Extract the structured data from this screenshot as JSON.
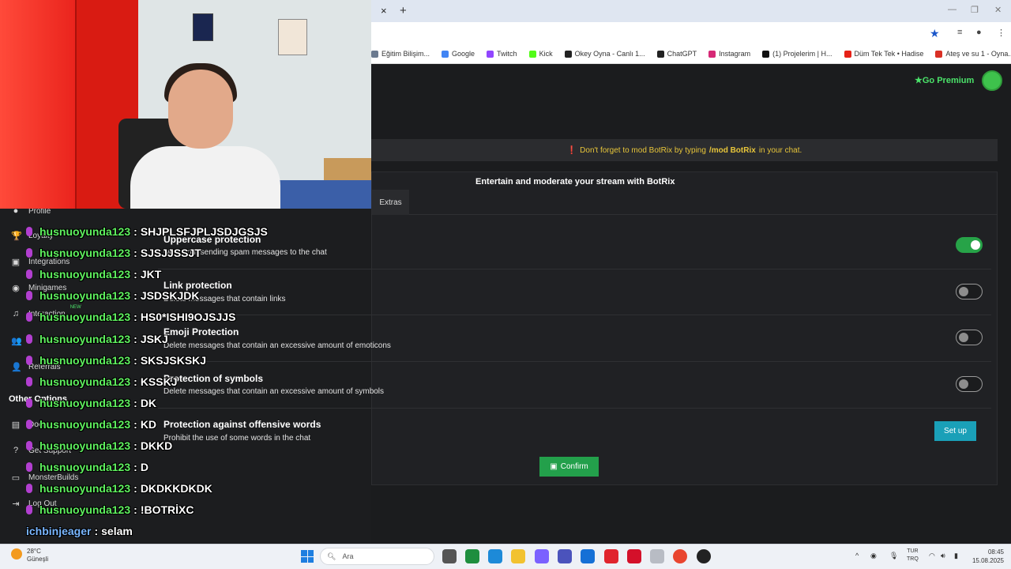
{
  "browser": {
    "close_glyph": "×",
    "new_tab_glyph": "+",
    "window_controls": [
      "—",
      "❐",
      "✕"
    ],
    "bookmarks": [
      {
        "label": "Eğitim Bilişim...",
        "color": "#6b7a8f"
      },
      {
        "label": "Google",
        "color": "#4285f4"
      },
      {
        "label": "Twitch",
        "color": "#9146ff"
      },
      {
        "label": "Kick",
        "color": "#53fc18"
      },
      {
        "label": "Okey Oyna - Canlı 1...",
        "color": "#222222"
      },
      {
        "label": "ChatGPT",
        "color": "#222222"
      },
      {
        "label": "Instagram",
        "color": "#d62976"
      },
      {
        "label": "(1) Projelerim | H...",
        "color": "#111111"
      },
      {
        "label": "Düm Tek Tek • Hadise",
        "color": "#e62117"
      },
      {
        "label": "Ateş ve su 1 - Oyna...",
        "color": "#d93025"
      }
    ]
  },
  "header": {
    "premium_label": "Go Premium",
    "premium_icon": "star-icon"
  },
  "notice": {
    "prefix": "Don't forget to mod BotRix by typing",
    "command": "/mod BotRix",
    "suffix": "in your chat.",
    "icon": "warning-icon"
  },
  "card": {
    "title": "Entertain and moderate your stream with BotRix",
    "active_tab": "Extras"
  },
  "options": [
    {
      "title": "Uppercase protection",
      "desc": "wers from sending spam messages to the chat",
      "enabled": true
    },
    {
      "title": "Link protection",
      "desc": "Delete messages that contain links",
      "enabled": false
    },
    {
      "title": "Emoji Protection",
      "desc": "Delete messages that contain an excessive amount of emoticons",
      "enabled": false
    },
    {
      "title": "Protection of symbols",
      "desc": "Delete messages that contain an excessive amount of symbols",
      "enabled": false
    },
    {
      "title": "Protection against offensive words",
      "desc": "Prohibit the use of some words in the chat",
      "action": "Set up"
    }
  ],
  "confirm_label": "Confirm",
  "sidebar": {
    "items": [
      {
        "label": "Profile",
        "icon": "user-icon"
      },
      {
        "label": "Loyalty",
        "icon": "trophy-icon"
      },
      {
        "label": "Integrations",
        "icon": "plug-icon"
      },
      {
        "label": "Minigames",
        "icon": "gamepad-icon"
      },
      {
        "label": "Interaction",
        "icon": "music-icon",
        "badge": "NEW"
      },
      {
        "label": "",
        "icon": "users-icon"
      },
      {
        "label": "Referrals",
        "icon": "people-icon"
      }
    ],
    "other_heading": "Other Options",
    "other_items": [
      {
        "label": "Docs",
        "icon": "doc-icon"
      },
      {
        "label": "Get Support",
        "icon": "help-icon"
      },
      {
        "label": "MonsterBuilds",
        "icon": "laptop-icon"
      },
      {
        "label": "Log Out",
        "icon": "logout-icon"
      }
    ]
  },
  "chat": [
    {
      "user": "husnuoyunda123",
      "msg": "SHJPLSFJPLJSDJGSJS"
    },
    {
      "user": "husnuoyunda123",
      "msg": "SJSJJSSJT"
    },
    {
      "user": "husnuoyunda123",
      "msg": "JKT"
    },
    {
      "user": "husnuoyunda123",
      "msg": "JSDSKJDK"
    },
    {
      "user": "husnuoyunda123",
      "msg": "HS0*ISHI9OJSJJS"
    },
    {
      "user": "husnuoyunda123",
      "msg": "JSKJ"
    },
    {
      "user": "husnuoyunda123",
      "msg": "SKSJSKSKJ"
    },
    {
      "user": "husnuoyunda123",
      "msg": "KSSKJ"
    },
    {
      "user": "husnuoyunda123",
      "msg": "DK"
    },
    {
      "user": "husnuoyunda123",
      "msg": "KD"
    },
    {
      "user": "husnuoyunda123",
      "msg": "DKKD"
    },
    {
      "user": "husnuoyunda123",
      "msg": "D"
    },
    {
      "user": "husnuoyunda123",
      "msg": "DKDKKDKDK"
    },
    {
      "user": "husnuoyunda123",
      "msg": "!BOTRİXC"
    },
    {
      "user": "ichbinjeager",
      "msg": "selam",
      "alt": true
    }
  ],
  "taskbar": {
    "temperature": "28°C",
    "weather": "Güneşli",
    "search_placeholder": "Ara",
    "lang_top": "TUR",
    "lang_bottom": "TRQ",
    "time": "08:45",
    "date": "15.08.2025"
  }
}
